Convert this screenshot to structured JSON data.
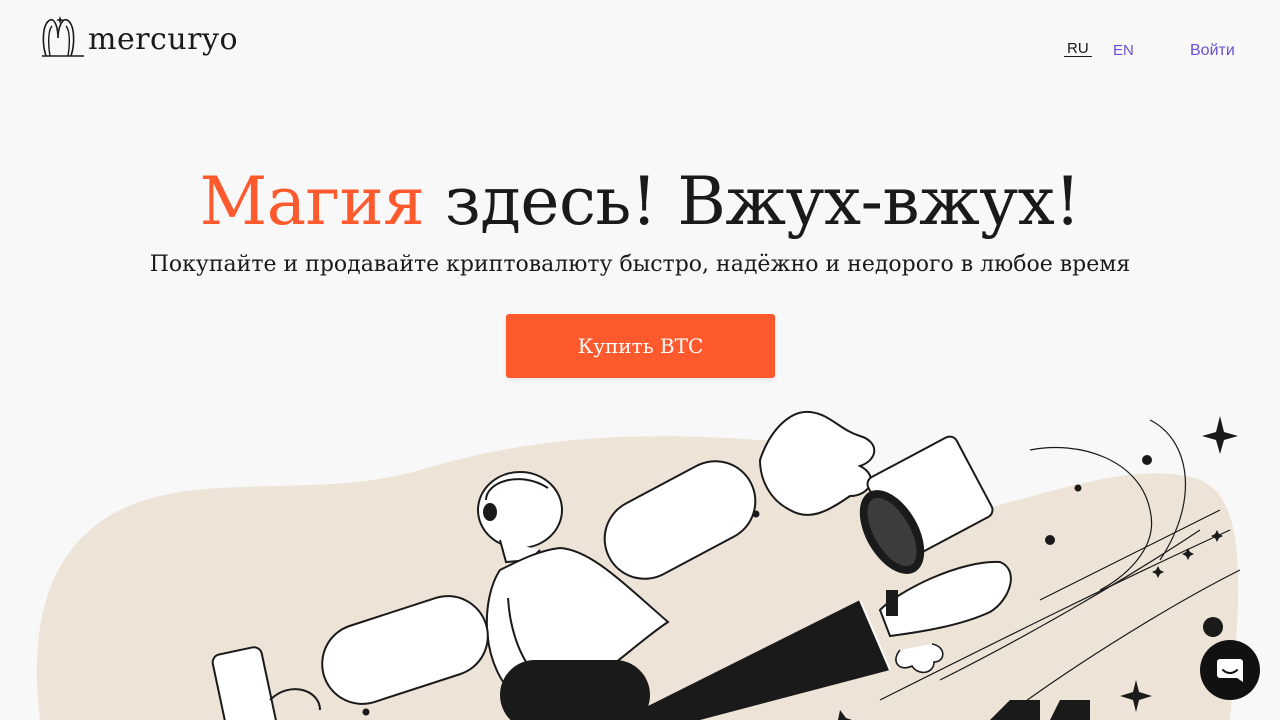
{
  "header": {
    "logo_text": "mercuryo",
    "lang_ru": "RU",
    "lang_en": "EN",
    "login": "Войти"
  },
  "hero": {
    "title_accent": "Магия",
    "title_rest": " здесь! Вжух-вжух!",
    "subtitle": "Покупайте и продавайте криптовалюту быстро, надёжно и недорого в любое время",
    "cta_label": "Купить BTC"
  },
  "colors": {
    "accent": "#ff5a2e",
    "link": "#6a4fd0",
    "blob": "#ede3d6",
    "background": "#f8f8f8"
  },
  "icons": {
    "logo": "mercuryo-logo-icon",
    "chat": "chat-icon"
  }
}
